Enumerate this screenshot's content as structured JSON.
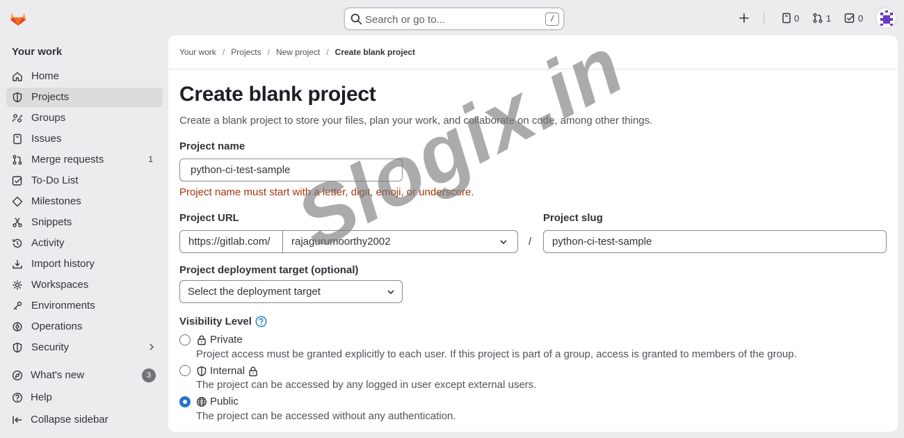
{
  "search": {
    "placeholder": "Search or go to...",
    "shortcut": "/"
  },
  "topbar": {
    "issues_count": "0",
    "mr_count": "1",
    "todo_count": "0"
  },
  "sidebar": {
    "title": "Your work",
    "items": [
      {
        "label": "Home",
        "icon": "home-icon"
      },
      {
        "label": "Projects",
        "icon": "project-icon"
      },
      {
        "label": "Groups",
        "icon": "group-icon"
      },
      {
        "label": "Issues",
        "icon": "issues-icon"
      },
      {
        "label": "Merge requests",
        "icon": "merge-request-icon",
        "count": "1"
      },
      {
        "label": "To-Do List",
        "icon": "todo-icon"
      },
      {
        "label": "Milestones",
        "icon": "milestone-icon"
      },
      {
        "label": "Snippets",
        "icon": "snippet-icon"
      },
      {
        "label": "Activity",
        "icon": "history-icon"
      },
      {
        "label": "Import history",
        "icon": "import-icon"
      },
      {
        "label": "Workspaces",
        "icon": "workspace-icon"
      },
      {
        "label": "Environments",
        "icon": "environment-icon"
      },
      {
        "label": "Operations",
        "icon": "operations-icon"
      },
      {
        "label": "Security",
        "icon": "shield-icon"
      }
    ],
    "whats_new": {
      "label": "What's new",
      "count": "3"
    },
    "help": "Help",
    "collapse": "Collapse sidebar"
  },
  "breadcrumb": [
    "Your work",
    "Projects",
    "New project",
    "Create blank project"
  ],
  "page": {
    "title": "Create blank project",
    "description": "Create a blank project to store your files, plan your work, and collaborate on code, among other things."
  },
  "form": {
    "project_name_label": "Project name",
    "project_name_value": "python-ci-test-sample",
    "project_name_error": "Project name must start with a letter, digit, emoji, or underscore.",
    "project_url_label": "Project URL",
    "url_prefix": "https://gitlab.com/",
    "namespace": "rajagurumoorthy2002",
    "slash": "/",
    "project_slug_label": "Project slug",
    "project_slug_value": "python-ci-test-sample",
    "deployment_label": "Project deployment target (optional)",
    "deployment_placeholder": "Select the deployment target",
    "visibility_label": "Visibility Level",
    "visibility": [
      {
        "title": "Private",
        "description": "Project access must be granted explicitly to each user. If this project is part of a group, access is granted to members of the group.",
        "checked": false
      },
      {
        "title": "Internal",
        "description": "The project can be accessed by any logged in user except external users.",
        "checked": false
      },
      {
        "title": "Public",
        "description": "The project can be accessed without any authentication.",
        "checked": true
      }
    ]
  },
  "watermark": "Slogix.in",
  "colors": {
    "accent": "#1f75cb",
    "error": "#a4330b",
    "logo": "#e24329"
  }
}
